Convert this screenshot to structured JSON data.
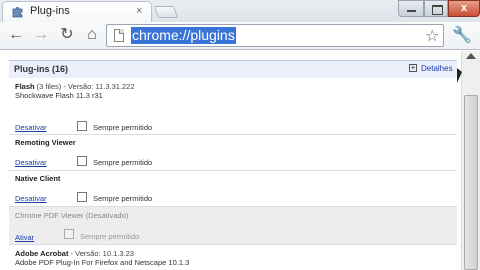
{
  "tab": {
    "title": "Plug-ins",
    "close": "×"
  },
  "window": {
    "close": "x"
  },
  "omnibox": {
    "url": "chrome://plugins"
  },
  "toolbar": {
    "back": "←",
    "forward": "→",
    "reload": "↻",
    "home": "⌂",
    "star": "☆",
    "wrench": "🔧"
  },
  "section": {
    "title": "Plug-ins (16)",
    "details_label": "Detalhes",
    "details_icon": "+"
  },
  "plugins": [
    {
      "name": "Flash",
      "info": " (3 files) - Versão: 11.3.31.222",
      "desc": "Shockwave Flash 11.3 r31",
      "action": "Desativar",
      "always_allowed": "Sempre permitido",
      "enabled": true
    },
    {
      "name": "Remoting Viewer",
      "info": "",
      "desc": "",
      "action": "Desativar",
      "always_allowed": "Sempre permitido",
      "enabled": true
    },
    {
      "name": "Native Client",
      "info": "",
      "desc": "",
      "action": "Desativar",
      "always_allowed": "Sempre permitido",
      "enabled": true
    },
    {
      "name": "Chrome PDF Viewer",
      "info": " (Desativado)",
      "desc": "",
      "action": "Ativar",
      "always_allowed": "Sempre permitido",
      "enabled": false
    },
    {
      "name": "Adobe Acrobat",
      "info": " - Versão: 10.1.3.23",
      "desc": "Adobe PDF Plug-In For Firefox and Netscape 10.1.3",
      "action": "",
      "always_allowed": "",
      "enabled": true
    }
  ]
}
